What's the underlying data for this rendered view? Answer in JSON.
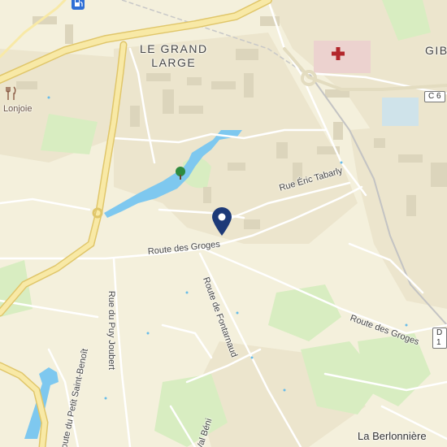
{
  "map": {
    "area_label": "LE GRAND\nLARGE",
    "edge_area_label": "GIB",
    "poi_label": "Lonjoie",
    "place_label": "La Berlonnière",
    "streets": {
      "tabarly": "Rue Éric Tabarly",
      "groges_west": "Route des Groges",
      "groges_east": "Route des Groges",
      "puy_joubert": "Rue du Puy Joubert",
      "fontarnaud": "Route de Fontarnaud",
      "petit_saint_benoit": "Route du Petit Saint-Benoît",
      "val_beni": "Val Béni"
    },
    "road_shields": [
      "C 6",
      "D 1"
    ],
    "icons": [
      "fuel-station-icon",
      "hospital-icon",
      "restaurant-icon",
      "park-tree-icon",
      "location-pin-icon"
    ],
    "colors": {
      "background": "#f4f0dc",
      "urban": "#ece6cf",
      "green": "#d7eec0",
      "water": "#7cc7ee",
      "main_road": "#f8e9a6",
      "pin": "#1d3a78",
      "hospital": "#e7c6c6"
    }
  }
}
